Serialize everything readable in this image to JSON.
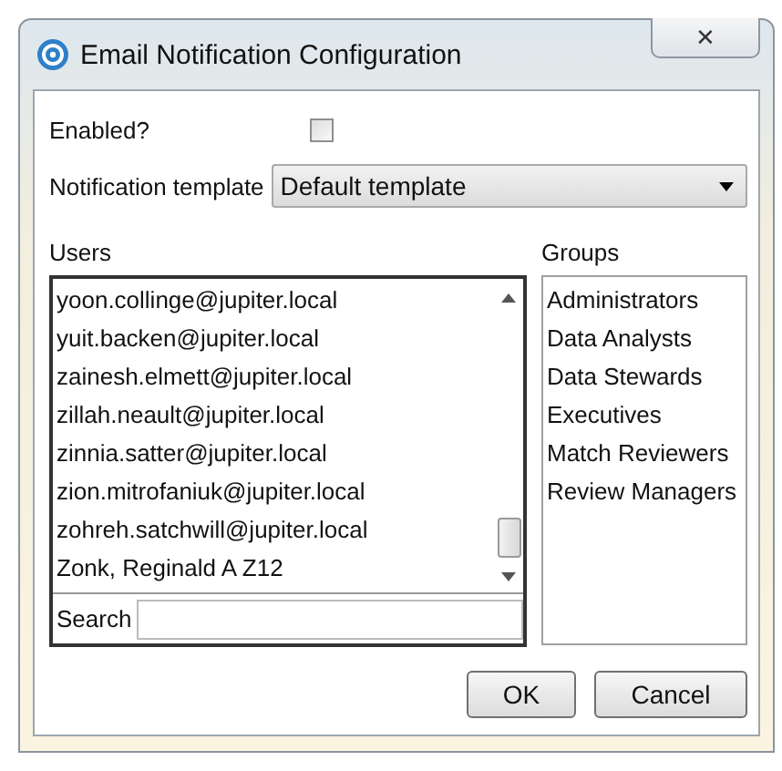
{
  "window": {
    "title": "Email Notification Configuration",
    "close": "✕"
  },
  "enabled": {
    "label": "Enabled?",
    "checked": false
  },
  "template": {
    "label": "Notification template",
    "value": "Default template"
  },
  "users": {
    "label": "Users",
    "items": [
      {
        "text": "yoon.collinge@jupiter.local"
      },
      {
        "text": "yuit.backen@jupiter.local"
      },
      {
        "text": "zainesh.elmett@jupiter.local"
      },
      {
        "text": "zillah.neault@jupiter.local"
      },
      {
        "text": "zinnia.satter@jupiter.local"
      },
      {
        "text": "zion.mitrofaniuk@jupiter.local"
      },
      {
        "text": "zohreh.satchwill@jupiter.local"
      },
      {
        "text": "Zonk, Reginald A Z12"
      }
    ],
    "search_label": "Search"
  },
  "groups": {
    "label": "Groups",
    "items": [
      "Administrators",
      "Data Analysts",
      "Data Stewards",
      "Executives",
      "Match Reviewers",
      "Review Managers"
    ]
  },
  "buttons": [
    "OK",
    "Cancel"
  ]
}
